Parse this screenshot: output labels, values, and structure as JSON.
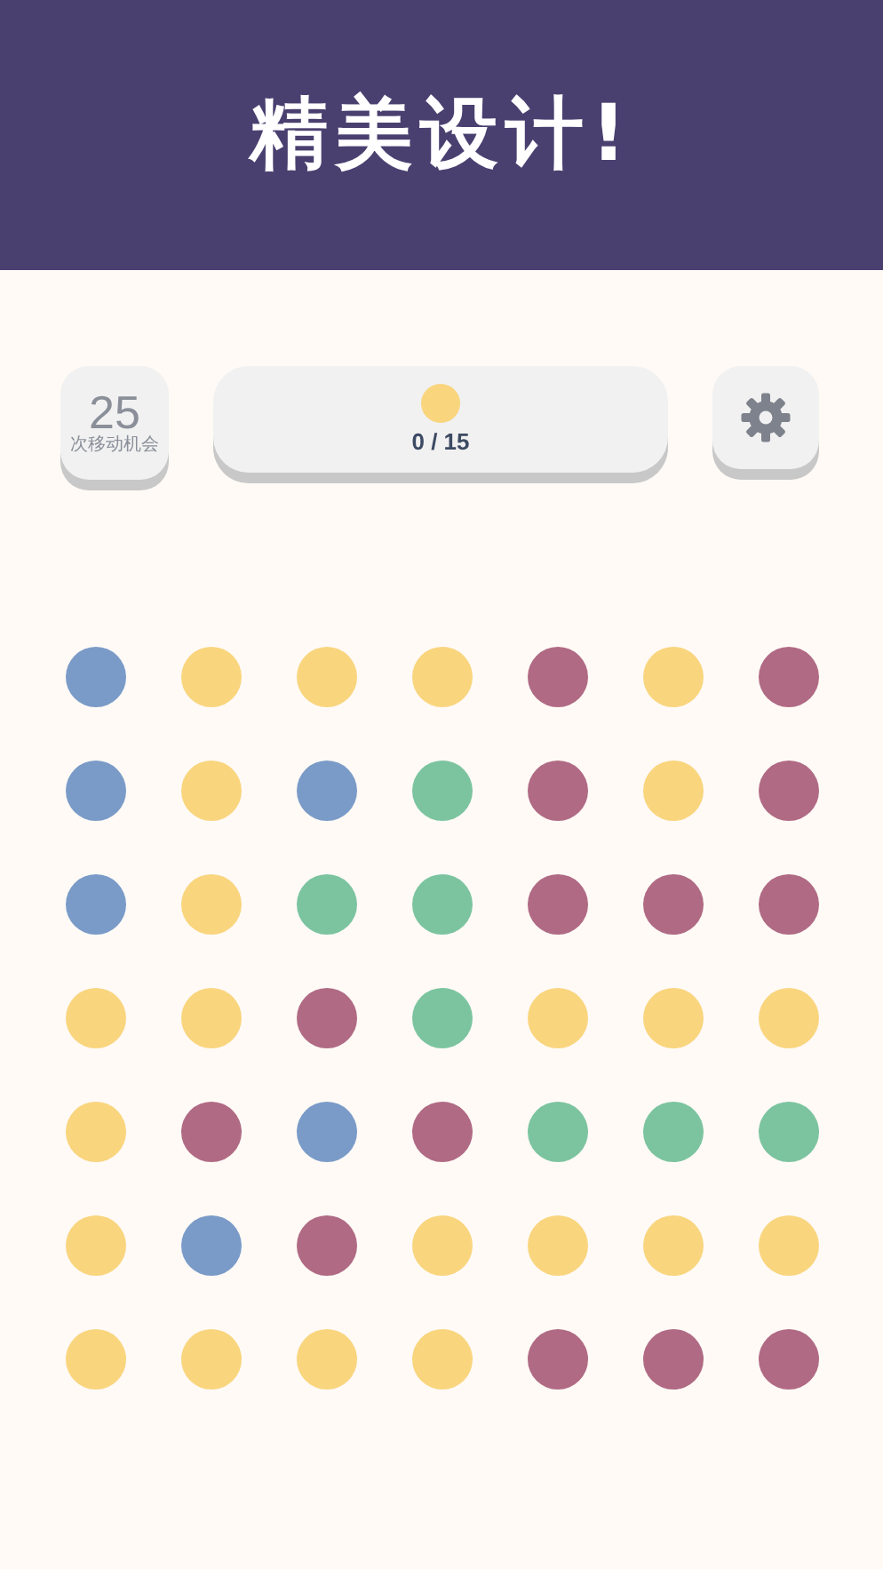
{
  "banner": {
    "title": "精美设计!"
  },
  "moves": {
    "count": "25",
    "label": "次移动机会"
  },
  "goal": {
    "color": "#f9d57e",
    "progress": "0 / 15"
  },
  "board": {
    "rows": [
      {
        "dots": [
          {
            "color": "#7a9bc8"
          },
          {
            "color": "#f9d57e"
          },
          {
            "color": "#f9d57e"
          },
          {
            "color": "#f9d57e"
          },
          {
            "color": "#b06a84"
          },
          {
            "color": "#f9d57e"
          },
          {
            "color": "#b06a84"
          }
        ]
      },
      {
        "dots": [
          {
            "color": "#7a9bc8"
          },
          {
            "color": "#f9d57e"
          },
          {
            "color": "#7a9bc8"
          },
          {
            "color": "#7cc4a0"
          },
          {
            "color": "#b06a84"
          },
          {
            "color": "#f9d57e"
          },
          {
            "color": "#b06a84"
          }
        ]
      },
      {
        "dots": [
          {
            "color": "#7a9bc8"
          },
          {
            "color": "#f9d57e"
          },
          {
            "color": "#7cc4a0"
          },
          {
            "color": "#7cc4a0"
          },
          {
            "color": "#b06a84"
          },
          {
            "color": "#b06a84"
          },
          {
            "color": "#b06a84"
          }
        ]
      },
      {
        "dots": [
          {
            "color": "#f9d57e"
          },
          {
            "color": "#f9d57e"
          },
          {
            "color": "#b06a84"
          },
          {
            "color": "#7cc4a0"
          },
          {
            "color": "#f9d57e"
          },
          {
            "color": "#f9d57e"
          },
          {
            "color": "#f9d57e"
          }
        ]
      },
      {
        "dots": [
          {
            "color": "#f9d57e"
          },
          {
            "color": "#b06a84"
          },
          {
            "color": "#7a9bc8"
          },
          {
            "color": "#b06a84"
          },
          {
            "color": "#7cc4a0"
          },
          {
            "color": "#7cc4a0"
          },
          {
            "color": "#7cc4a0"
          }
        ]
      },
      {
        "dots": [
          {
            "color": "#f9d57e"
          },
          {
            "color": "#7a9bc8"
          },
          {
            "color": "#b06a84"
          },
          {
            "color": "#f9d57e"
          },
          {
            "color": "#f9d57e"
          },
          {
            "color": "#f9d57e"
          },
          {
            "color": "#f9d57e"
          }
        ]
      },
      {
        "dots": [
          {
            "color": "#f9d57e"
          },
          {
            "color": "#f9d57e"
          },
          {
            "color": "#f9d57e"
          },
          {
            "color": "#f9d57e"
          },
          {
            "color": "#b06a84"
          },
          {
            "color": "#b06a84"
          },
          {
            "color": "#b06a84"
          }
        ]
      }
    ]
  }
}
